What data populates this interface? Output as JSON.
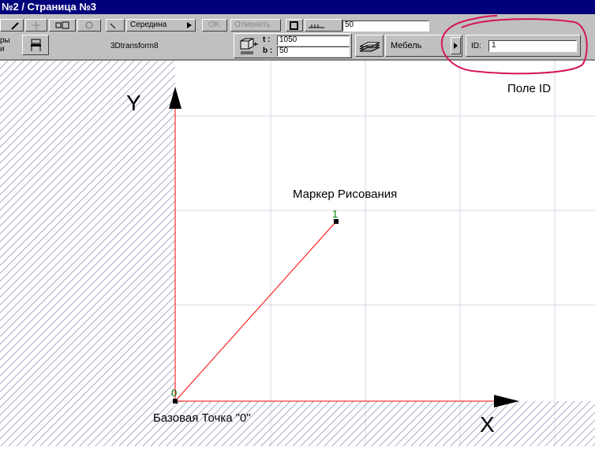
{
  "window": {
    "title": "№2 / Страница №3"
  },
  "toolbar1": {
    "position_value": "Середина",
    "ok_label": "OK",
    "cancel_label": "Отменить",
    "scale_value": "50"
  },
  "toolbar2": {
    "params_label_top": "ры",
    "params_label_bottom": "и",
    "object_name": "3Dtransform8",
    "t_label": "t :",
    "t_value": "1050",
    "b_label": "b :",
    "b_value": "50",
    "layer_value": "Мебель",
    "id_label": "ID:",
    "id_value": "1"
  },
  "annotations": {
    "id_field": "Поле  ID",
    "axis_y": "Y",
    "axis_x": "X",
    "drawing_marker": "Маркер Рисования",
    "base_point": "Базовая Точка \"0\"",
    "marker_number": "1",
    "origin_number": "0"
  },
  "colors": {
    "title_bar": "#00007b",
    "toolbar": "#c0c0c0",
    "grid": "#d8dae8",
    "hatch": "#a8aec8",
    "axis": "#ff0000",
    "highlight_circle": "#d4145a",
    "hotspot_number": "#008000"
  }
}
